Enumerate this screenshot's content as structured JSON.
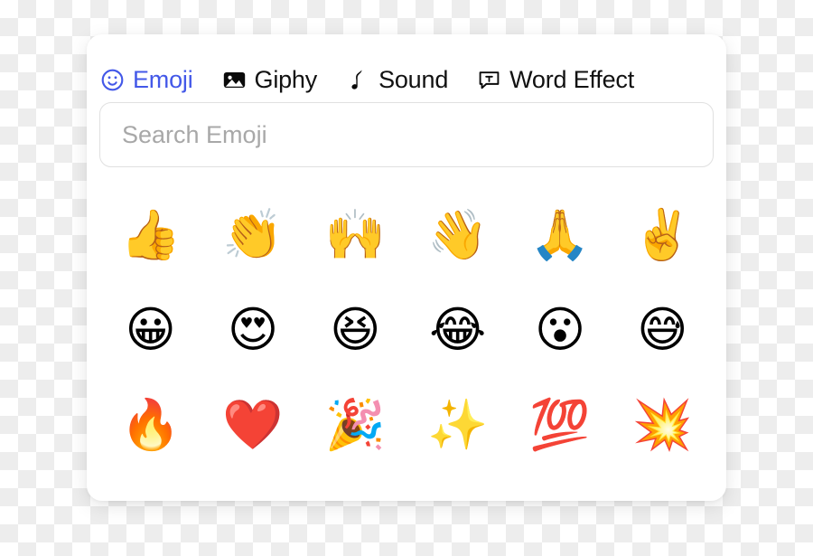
{
  "panel": {
    "background_color": "#ffffff",
    "accent_color": "#4358e8",
    "text_color": "#111111"
  },
  "tabs": [
    {
      "id": "emoji",
      "label": "Emoji",
      "icon": "smiley-face-icon",
      "active": true
    },
    {
      "id": "giphy",
      "label": "Giphy",
      "icon": "image-icon",
      "active": false
    },
    {
      "id": "sound",
      "label": "Sound",
      "icon": "music-note-icon",
      "active": false
    },
    {
      "id": "word-effect",
      "label": "Word Effect",
      "icon": "speech-text-icon",
      "active": false
    }
  ],
  "search": {
    "placeholder": "Search Emoji",
    "value": "",
    "placeholder_color": "#a8a8a8"
  },
  "emoji_grid": {
    "columns": 6,
    "rows": 3,
    "items": [
      {
        "glyph": "👍",
        "name": "thumbs-up"
      },
      {
        "glyph": "👏",
        "name": "clapping-hands"
      },
      {
        "glyph": "🙌",
        "name": "raising-hands"
      },
      {
        "glyph": "👋",
        "name": "waving-hand"
      },
      {
        "glyph": "🙏",
        "name": "folded-hands"
      },
      {
        "glyph": "✌️",
        "name": "victory-hand"
      },
      {
        "glyph": "😀",
        "name": "grinning-face"
      },
      {
        "glyph": "😍",
        "name": "smiling-face-with-heart-eyes"
      },
      {
        "glyph": "😆",
        "name": "grinning-squinting-face"
      },
      {
        "glyph": "😂",
        "name": "face-with-tears-of-joy"
      },
      {
        "glyph": "😮",
        "name": "face-with-open-mouth"
      },
      {
        "glyph": "😅",
        "name": "grinning-face-with-sweat"
      },
      {
        "glyph": "🔥",
        "name": "fire"
      },
      {
        "glyph": "❤️",
        "name": "red-heart"
      },
      {
        "glyph": "🎉",
        "name": "party-popper"
      },
      {
        "glyph": "✨",
        "name": "sparkles"
      },
      {
        "glyph": "💯",
        "name": "hundred-points"
      },
      {
        "glyph": "💥",
        "name": "collision"
      }
    ]
  }
}
